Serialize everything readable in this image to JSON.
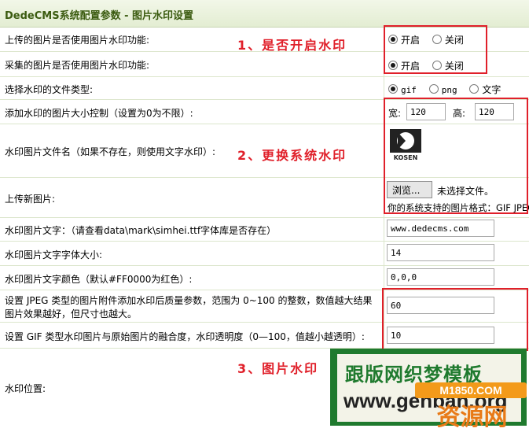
{
  "header": {
    "title": "DedeCMS系统配置参数 - 图片水印设置"
  },
  "rows": {
    "upload_watermark": {
      "label": "上传的图片是否使用图片水印功能:",
      "opt_on": "开启",
      "opt_off": "关闭"
    },
    "collect_watermark": {
      "label": "采集的图片是否使用图片水印功能:",
      "opt_on": "开启",
      "opt_off": "关闭"
    },
    "file_type": {
      "label": "选择水印的文件类型:",
      "opt_gif": "gif",
      "opt_png": "png",
      "opt_text": "文字"
    },
    "size_limit": {
      "label": "添加水印的图片大小控制（设置为0为不限）:",
      "width_label": "宽:",
      "width_value": "120",
      "height_label": "高:",
      "height_value": "120"
    },
    "wm_file": {
      "label": "水印图片文件名（如果不存在，则使用文字水印）:",
      "logo_text": "KOSEN"
    },
    "upload_new": {
      "label": "上传新图片:",
      "browse": "浏览...",
      "no_file": "未选择文件。",
      "hint": "你的系统支持的图片格式：GIF JPEG"
    },
    "wm_text": {
      "label": "水印图片文字：（请查看data\\mark\\simhei.ttf字体库是否存在）",
      "value": "www.dedecms.com"
    },
    "wm_font_size": {
      "label": "水印图片文字字体大小:",
      "value": "14"
    },
    "wm_color": {
      "label": "水印图片文字颜色（默认#FF0000为红色）:",
      "value": "0,0,0"
    },
    "jpeg_quality": {
      "label1": "设置 JPEG 类型的图片附件添加水印后质量参数，范围为 0~100 的整数，数值越大结果",
      "label2": "图片效果越好，但尺寸也越大。",
      "value": "60"
    },
    "gif_blend": {
      "label": "设置 GIF 类型水印图片与原始图片的融合度，水印透明度（0—100，值越小越透明）:",
      "value": "10"
    },
    "wm_position": {
      "label": "水印位置:"
    }
  },
  "annotations": {
    "a1": "1、是否开启水印",
    "a2": "2、更换系统水印",
    "a3": "3、图片水印"
  },
  "overlay": {
    "line1": "跟版网织梦模板",
    "line2": "www.genban.org",
    "badge": "M1850.COM",
    "brand": "资源网"
  }
}
